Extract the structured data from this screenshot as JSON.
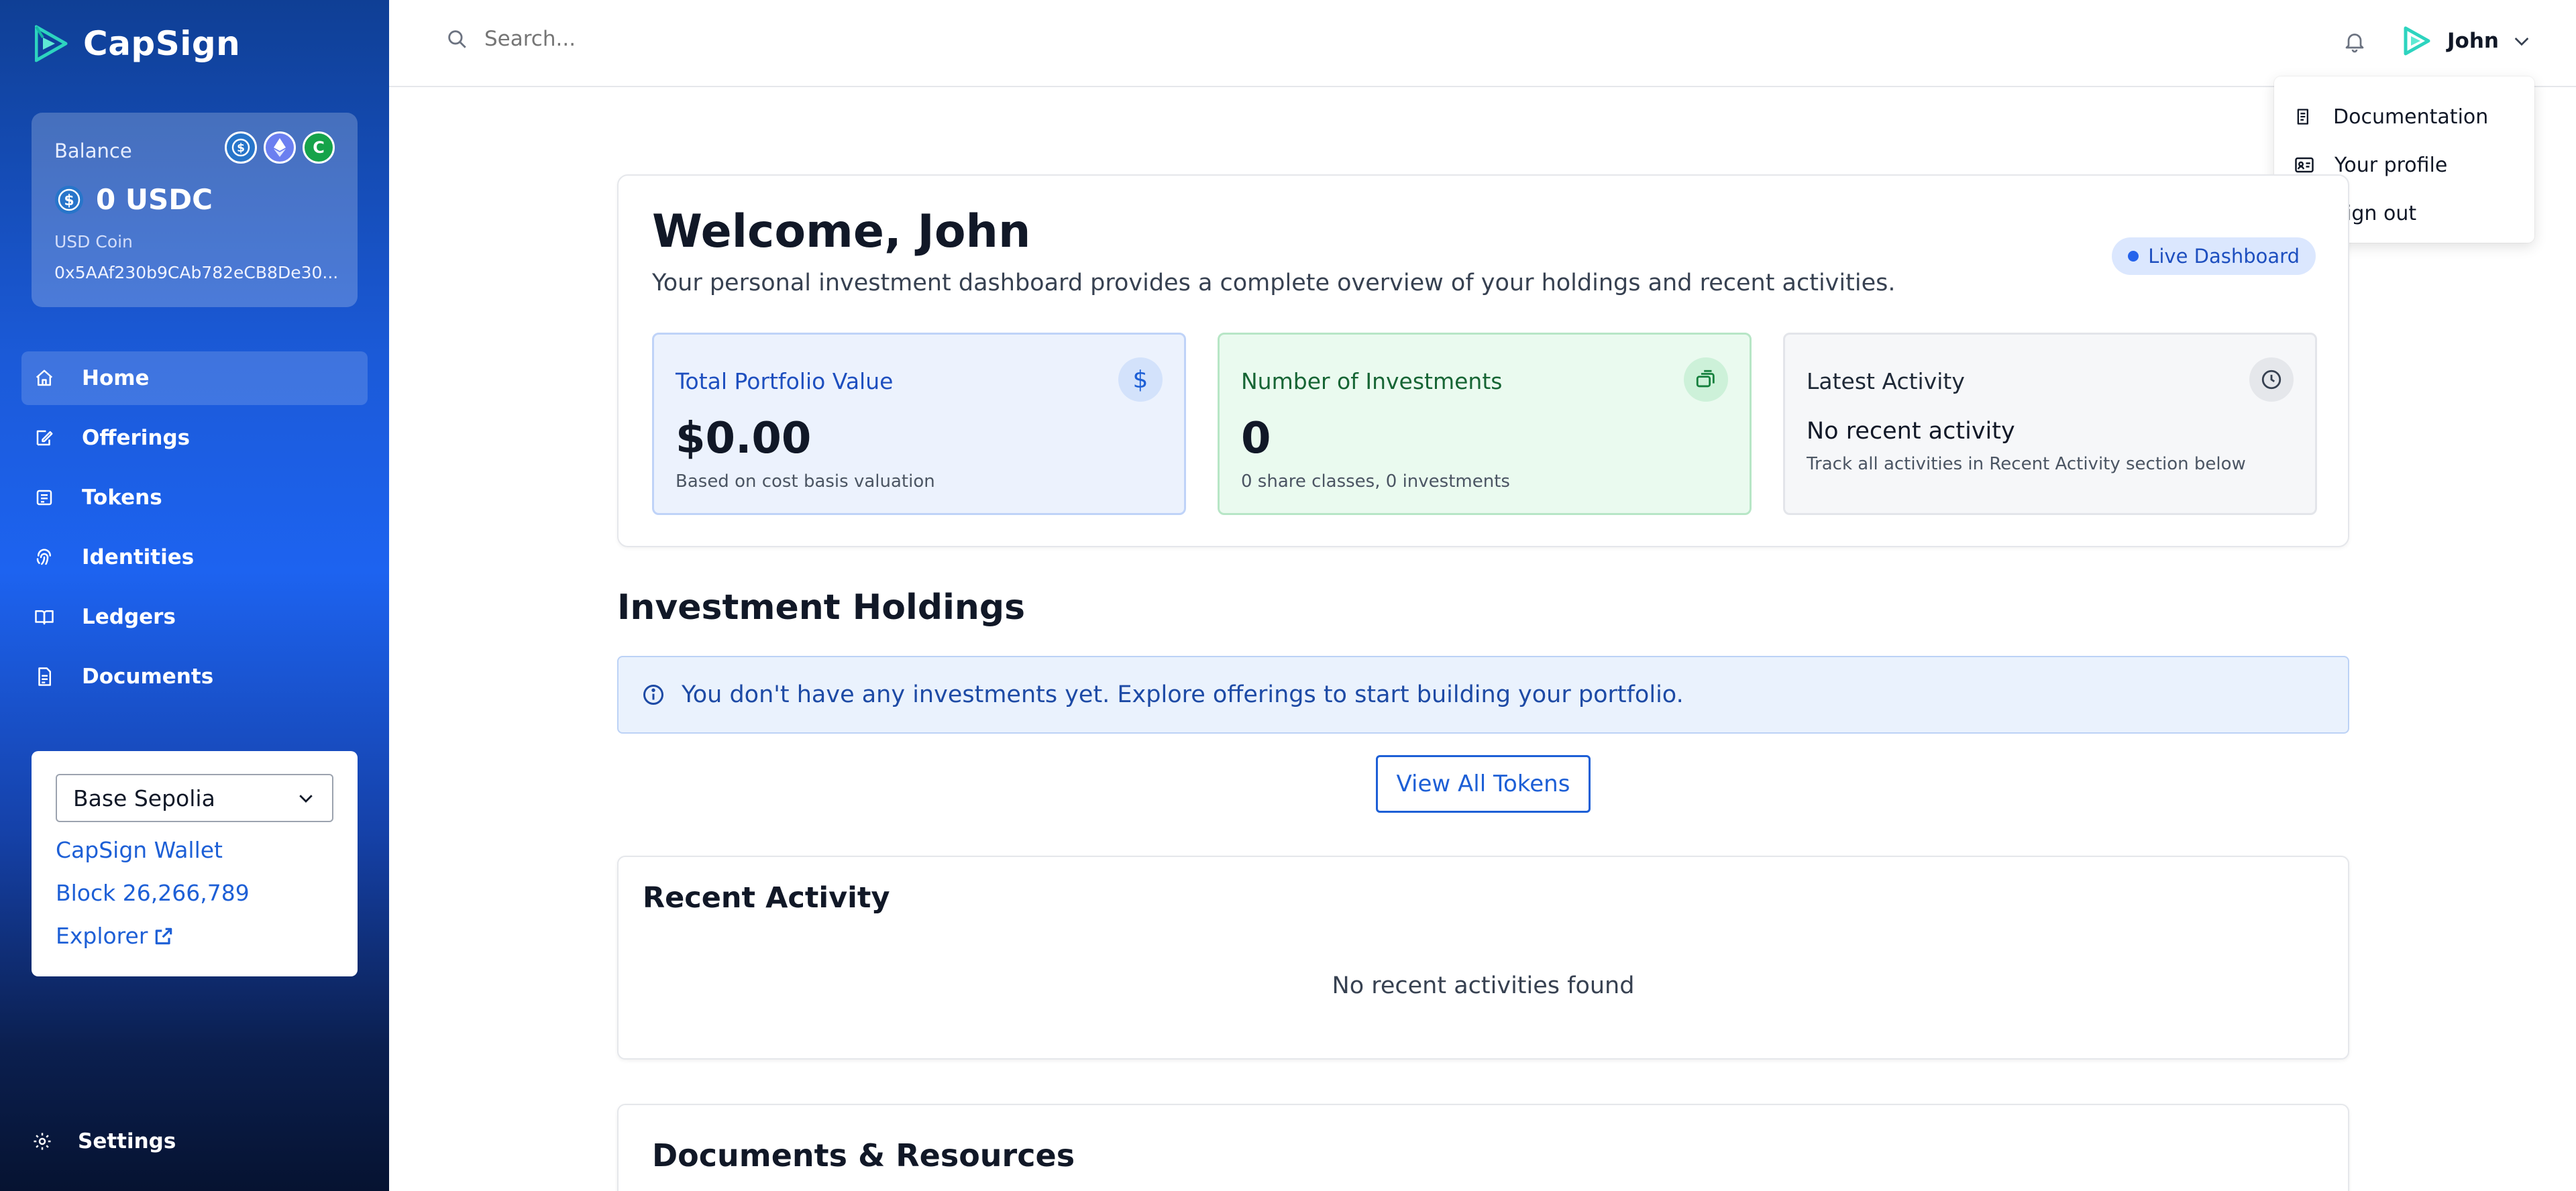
{
  "app": {
    "name": "CapSign"
  },
  "balance": {
    "label": "Balance",
    "amount": "0 USDC",
    "token_name": "USD Coin",
    "address": "0x5AAf230b9CAb782eCB8De30...",
    "coins": [
      "usdc-icon",
      "eth-icon",
      "capsign-coin-icon"
    ],
    "coin_c_label": "C"
  },
  "sidebar": {
    "items": [
      {
        "label": "Home",
        "icon": "home-icon",
        "active": true
      },
      {
        "label": "Offerings",
        "icon": "offering-icon"
      },
      {
        "label": "Tokens",
        "icon": "token-icon"
      },
      {
        "label": "Identities",
        "icon": "fingerprint-icon"
      },
      {
        "label": "Ledgers",
        "icon": "book-icon"
      },
      {
        "label": "Documents",
        "icon": "document-icon"
      }
    ],
    "settings_label": "Settings"
  },
  "network": {
    "selected": "Base Sepolia",
    "wallet_label": "CapSign Wallet",
    "block_label": "Block 26,266,789",
    "explorer_label": "Explorer"
  },
  "header": {
    "search_placeholder": "Search...",
    "user_name": "John"
  },
  "user_menu": {
    "items": [
      {
        "label": "Documentation",
        "icon": "document-icon"
      },
      {
        "label": "Your profile",
        "icon": "id-card-icon"
      },
      {
        "label": "Sign out",
        "icon": "sign-out-icon"
      }
    ]
  },
  "welcome": {
    "title": "Welcome, John",
    "subtitle": "Your personal investment dashboard provides a complete overview of your holdings and recent activities.",
    "badge": "Live Dashboard"
  },
  "stats": {
    "portfolio": {
      "title": "Total Portfolio Value",
      "value": "$0.00",
      "note": "Based on cost basis valuation",
      "icon_glyph": "$"
    },
    "investments": {
      "title": "Number of Investments",
      "value": "0",
      "note": "0 share classes, 0 investments"
    },
    "activity": {
      "title": "Latest Activity",
      "value": "No recent activity",
      "note": "Track all activities in Recent Activity section below"
    }
  },
  "holdings": {
    "title": "Investment Holdings",
    "empty_message": "You don't have any investments yet. Explore offerings to start building your portfolio.",
    "view_tokens_label": "View All Tokens"
  },
  "recent_activity": {
    "title": "Recent Activity",
    "empty_message": "No recent activities found"
  },
  "documents": {
    "title": "Documents & Resources"
  },
  "colors": {
    "accent": "#1d5fd6",
    "sidebar_top": "#0f3f95",
    "sidebar_mid": "#1d63f0",
    "sidebar_bottom": "#061331",
    "portfolio_bg": "#ecf2fd",
    "investments_bg": "#eafaef",
    "activity_bg": "#f6f7f9",
    "live_dot": "#2563eb"
  }
}
